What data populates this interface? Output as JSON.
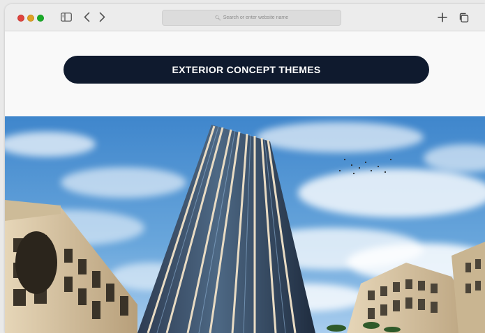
{
  "browser": {
    "address_placeholder": "Search or enter website name",
    "traffic_lights": [
      "#e0443e",
      "#dea123",
      "#1aab29"
    ]
  },
  "page": {
    "banner_title": "EXTERIOR CONCEPT THEMES"
  },
  "colors": {
    "banner_bg": "#0f1a2e",
    "sky": "#4a8fd0"
  },
  "icons": [
    "sidebar-icon",
    "back-chevron-icon",
    "forward-chevron-icon",
    "search-icon",
    "new-tab-plus-icon",
    "tabs-overview-icon"
  ]
}
